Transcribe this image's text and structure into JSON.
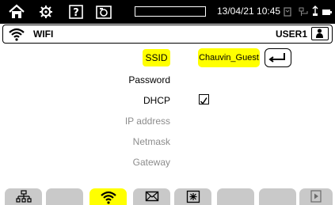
{
  "topbar": {
    "home_icon": "home-icon",
    "settings_icon": "gear-icon",
    "help_icon": "help-icon",
    "camera_icon": "camera-icon",
    "datetime": "13/04/21 10:45"
  },
  "header": {
    "title": "WIFI",
    "icon": "wifi-icon",
    "user": "USER1",
    "user_icon": "user-icon"
  },
  "form": {
    "ssid_label": "SSID",
    "ssid_value": "Chauvin_Guest",
    "password_label": "Password",
    "dhcp_label": "DHCP",
    "dhcp_checked": true,
    "ip_label": "IP address",
    "netmask_label": "Netmask",
    "gateway_label": "Gateway"
  },
  "tabs": [
    {
      "icon": "network-icon",
      "active": false
    },
    {
      "icon": "",
      "active": false
    },
    {
      "icon": "wifi-icon",
      "active": true
    },
    {
      "icon": "envelope-icon",
      "active": false
    },
    {
      "icon": "sync-icon",
      "active": false
    },
    {
      "icon": "",
      "active": false
    },
    {
      "icon": "",
      "active": false
    },
    {
      "icon": "play-icon",
      "active": false
    }
  ],
  "colors": {
    "highlight": "#ffff00",
    "topbar": "#000000",
    "tab_inactive": "#c9c9c9",
    "dim_text": "#8c8c8c"
  }
}
